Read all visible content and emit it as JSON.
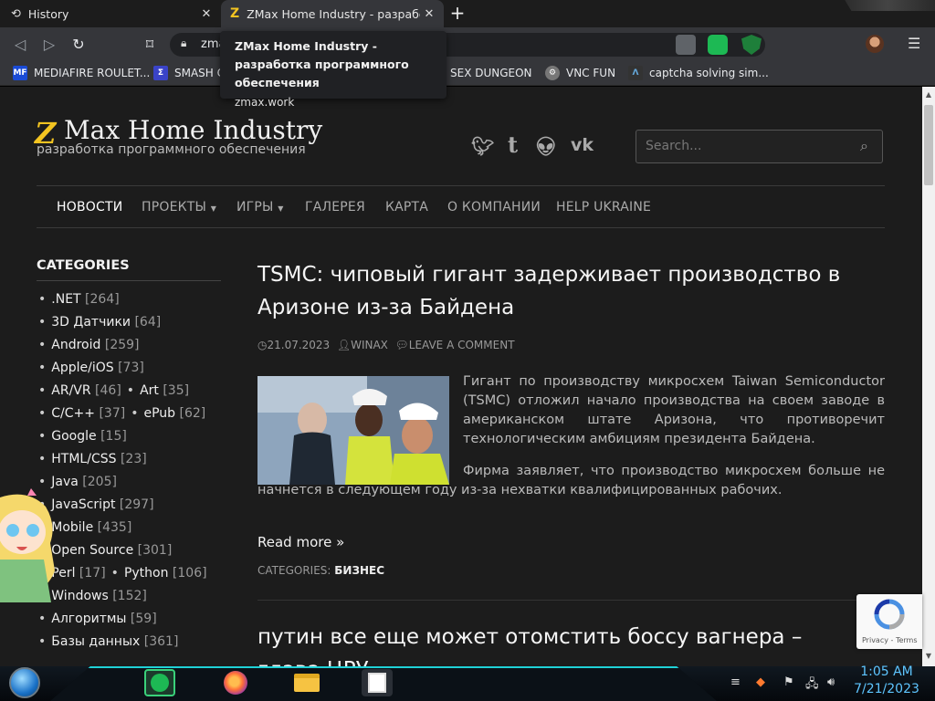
{
  "browser": {
    "tabs": [
      {
        "label": "History",
        "active": false
      },
      {
        "label": "ZMax Home Industry - разработка программного обеспечения",
        "active": true
      }
    ],
    "address": "zma",
    "tooltip": {
      "title": "ZMax Home Industry - разработка программного обеспечения",
      "url": "zmax.work"
    },
    "bookmarks": [
      {
        "label": "MEDIAFIRE ROULET...",
        "icon": "mediafire-icon",
        "color": "#1a4bd6"
      },
      {
        "label": "SMASH C",
        "icon": "smash-icon",
        "color": "#3a43c8"
      },
      {
        "label": "SEX DUNGEON",
        "icon": "",
        "color": ""
      },
      {
        "label": "VNC FUN",
        "icon": "vnc-icon",
        "color": "#888888"
      },
      {
        "label": "captcha solving sim...",
        "icon": "captcha-icon",
        "color": "#333333"
      }
    ]
  },
  "site": {
    "logo_letter": "Z",
    "logo_text": "Max Home Industry",
    "tagline": "разработка программного обеспечения",
    "social": [
      "twitter-icon",
      "tumblr-icon",
      "reddit-icon",
      "vk-icon"
    ],
    "search_placeholder": "Search...",
    "nav": [
      {
        "label": "НОВОСТИ",
        "current": true,
        "dropdown": false
      },
      {
        "label": "ПРОЕКТЫ",
        "current": false,
        "dropdown": true
      },
      {
        "label": "ИГРЫ",
        "current": false,
        "dropdown": true
      },
      {
        "label": "ГАЛЕРЕЯ",
        "current": false,
        "dropdown": false
      },
      {
        "label": "КАРТА",
        "current": false,
        "dropdown": false
      },
      {
        "label": "О КОМПАНИИ",
        "current": false,
        "dropdown": false
      },
      {
        "label": "HELP UKRAINE",
        "current": false,
        "dropdown": false
      }
    ]
  },
  "sidebar": {
    "title": "CATEGORIES",
    "rows": [
      [
        {
          "name": ".NET",
          "count": "[264]"
        }
      ],
      [
        {
          "name": "3D Датчики",
          "count": "[64]"
        }
      ],
      [
        {
          "name": "Android",
          "count": "[259]"
        }
      ],
      [
        {
          "name": "Apple/iOS",
          "count": "[73]"
        }
      ],
      [
        {
          "name": "AR/VR",
          "count": "[46]"
        },
        {
          "name": "Art",
          "count": "[35]"
        }
      ],
      [
        {
          "name": "C/C++",
          "count": "[37]"
        },
        {
          "name": "ePub",
          "count": "[62]"
        }
      ],
      [
        {
          "name": "Google",
          "count": "[15]"
        }
      ],
      [
        {
          "name": "HTML/CSS",
          "count": "[23]"
        }
      ],
      [
        {
          "name": "Java",
          "count": "[205]"
        }
      ],
      [
        {
          "name": "JavaScript",
          "count": "[297]"
        }
      ],
      [
        {
          "name": "Mobile",
          "count": "[435]"
        }
      ],
      [
        {
          "name": "Open Source",
          "count": "[301]"
        }
      ],
      [
        {
          "name": "Perl",
          "count": "[17]"
        },
        {
          "name": "Python",
          "count": "[106]"
        }
      ],
      [
        {
          "name": "Windows",
          "count": "[152]"
        }
      ],
      [
        {
          "name": "Алгоритмы",
          "count": "[59]"
        }
      ],
      [
        {
          "name": "Базы данных",
          "count": "[361]"
        }
      ]
    ]
  },
  "post": {
    "title": "TSMC: чиповый гигант задерживает производство в Аризоне из-за Байдена",
    "date": "21.07.2023",
    "author": "WINAX",
    "comment": "LEAVE A COMMENT",
    "para1": "Гигант по производству микросхем Taiwan Semiconductor (TSMC) отложил начало производства на своем заводе в американском штате Аризона, что противоречит технологическим амбициям президента Байдена.",
    "para2": "Фирма заявляет, что производство микросхем больше не начнется в следующем году из-за нехватки квалифицированных рабочих.",
    "read_more": "Read more »",
    "categories_label": "CATEGORIES:",
    "category": "БИЗНЕС"
  },
  "post2": {
    "title": "путин все еще может отомстить боссу вагнера – глава ЦРУ"
  },
  "recaptcha": {
    "terms": "Privacy - Terms"
  },
  "taskbar": {
    "time": "1:05 AM",
    "date": "7/21/2023",
    "apps": [
      "chat-app-icon",
      "firefox-icon",
      "file-explorer-icon",
      "window-switch-icon"
    ]
  }
}
